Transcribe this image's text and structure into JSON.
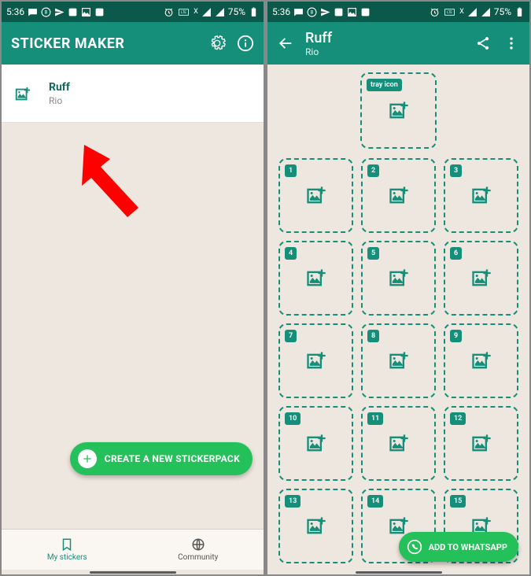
{
  "statusbar": {
    "time": "5:36",
    "battery": "75%"
  },
  "left": {
    "app_title": "STICKER MAKER",
    "pack": {
      "name": "Ruff",
      "author": "Rio"
    },
    "fab_label": "CREATE A NEW STICKERPACK",
    "tabs": {
      "my_stickers": "My stickers",
      "community": "Community"
    }
  },
  "right": {
    "title": "Ruff",
    "subtitle": "Rio",
    "tray_label": "tray icon",
    "slots": [
      "1",
      "2",
      "3",
      "4",
      "5",
      "6",
      "7",
      "8",
      "9",
      "10",
      "11",
      "12",
      "13",
      "14",
      "15"
    ],
    "whatsapp_label": "ADD TO WHATSAPP"
  }
}
